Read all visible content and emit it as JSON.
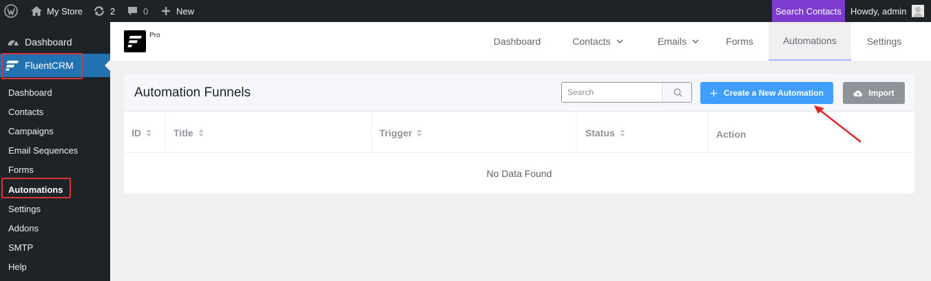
{
  "admin_bar": {
    "site_name": "My Store",
    "updates_count": "2",
    "comments_count": "0",
    "new_label": "New",
    "search_contacts_label": "Search Contacts",
    "howdy_label": "Howdy, admin"
  },
  "sidebar": {
    "dashboard_label": "Dashboard",
    "plugin_label": "FluentCRM",
    "submenu": [
      {
        "label": "Dashboard"
      },
      {
        "label": "Contacts"
      },
      {
        "label": "Campaigns"
      },
      {
        "label": "Email Sequences"
      },
      {
        "label": "Forms"
      },
      {
        "label": "Automations",
        "active": true
      },
      {
        "label": "Settings"
      },
      {
        "label": "Addons"
      },
      {
        "label": "SMTP"
      },
      {
        "label": "Help"
      }
    ]
  },
  "crm_header": {
    "badge": "Pro",
    "nav": [
      {
        "label": "Dashboard"
      },
      {
        "label": "Contacts",
        "dropdown": true
      },
      {
        "label": "Emails",
        "dropdown": true
      },
      {
        "label": "Forms"
      },
      {
        "label": "Automations",
        "active": true
      },
      {
        "label": "Settings"
      }
    ]
  },
  "funnels": {
    "title": "Automation Funnels",
    "search_placeholder": "Search",
    "create_button": "Create a New Automation",
    "import_button": "Import",
    "columns": [
      {
        "label": "ID",
        "sortable": true
      },
      {
        "label": "Title",
        "sortable": true
      },
      {
        "label": "Trigger",
        "sortable": true
      },
      {
        "label": "Status",
        "sortable": true
      },
      {
        "label": "Action",
        "sortable": false
      }
    ],
    "empty_text": "No Data Found"
  },
  "colors": {
    "admin_bar_bg": "#1d2327",
    "search_contacts_bg": "#7e3bd0",
    "wp_blue": "#2271b1",
    "primary_button": "#409eff",
    "import_button": "#909399",
    "highlight_red": "#d63638"
  },
  "icons": {
    "wordpress": "wordpress-logo-icon",
    "home": "home-icon",
    "updates": "updates-icon",
    "comments": "comment-icon",
    "new": "plus-icon",
    "dashboard": "dashboard-gauge-icon",
    "fluentcrm": "fluentcrm-logo-icon",
    "search": "search-icon",
    "import": "cloud-upload-icon",
    "sort": "sort-caret-icon"
  }
}
